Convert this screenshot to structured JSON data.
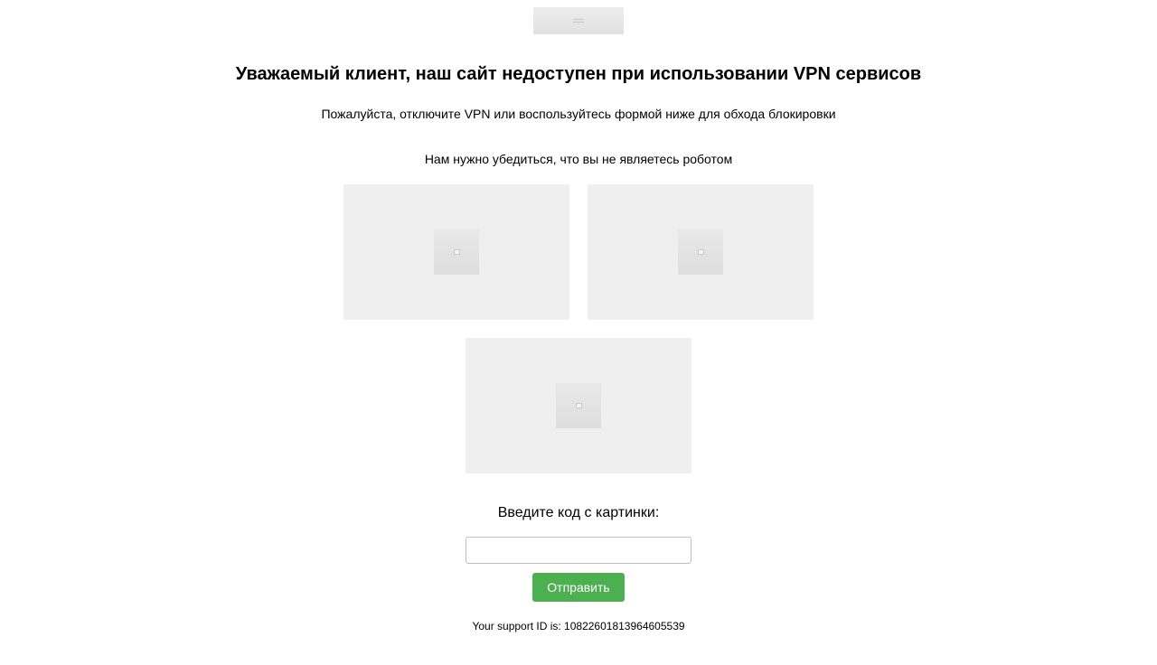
{
  "page": {
    "title": "Уважаемый клиент, наш сайт недоступен при использовании VPN сервисов",
    "subtitle": "Пожалуйста, отключите VPN или воспользуйтесь формой ниже для обхода блокировки",
    "robot_note": "Нам нужно убедиться, что вы не являетесь роботом"
  },
  "logo": {
    "icon": "logo-image"
  },
  "captcha": {
    "images": [
      {
        "icon": "broken-image-icon"
      },
      {
        "icon": "broken-image-icon"
      },
      {
        "icon": "broken-image-icon"
      }
    ],
    "code_label": "Введите код с картинки:",
    "code_input": {
      "value": "",
      "placeholder": ""
    },
    "submit_label": "Отправить"
  },
  "support": {
    "text": "Your support ID is: 10822601813964605539"
  },
  "colors": {
    "background": "#ffffff",
    "submit_button": "#4caf50",
    "captcha_box": "#efefef"
  }
}
